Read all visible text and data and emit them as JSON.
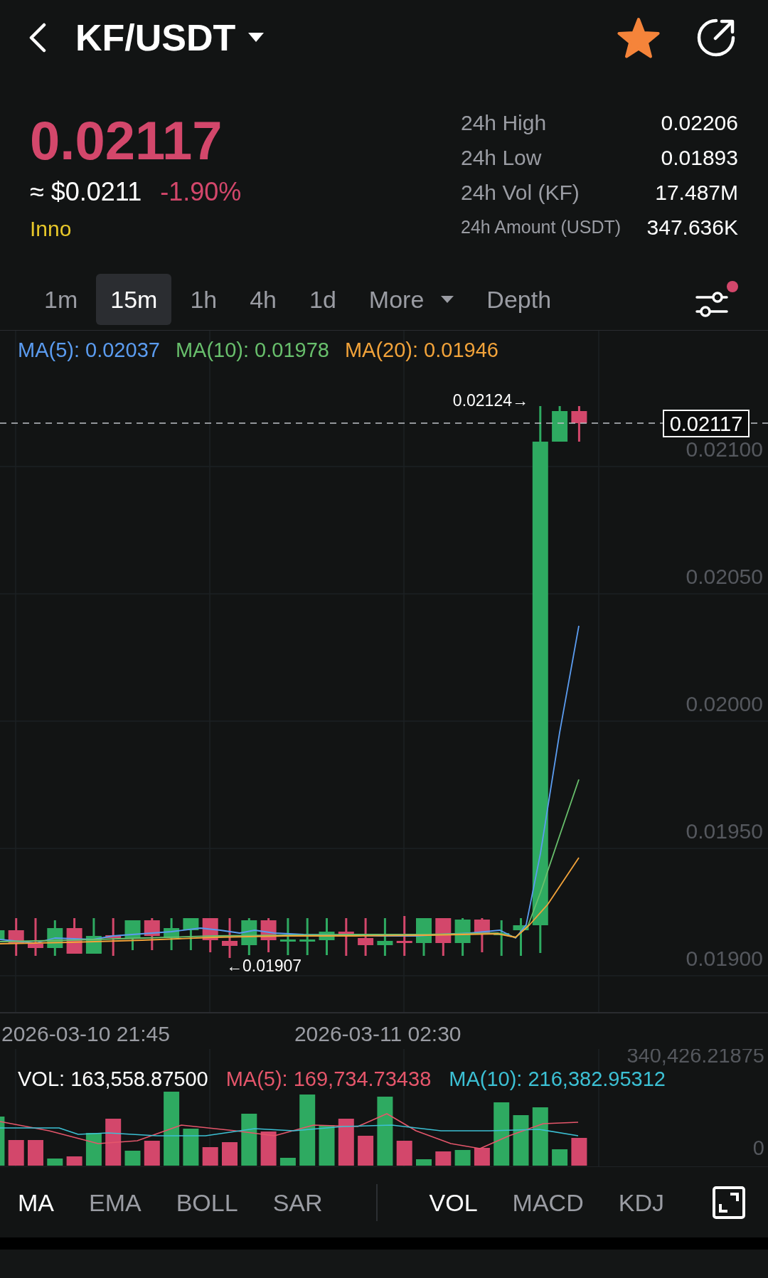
{
  "header": {
    "title": "KF/USDT",
    "favorite": true
  },
  "ticker": {
    "price": "0.02117",
    "falling": true,
    "usd_price": "≈ $0.0211",
    "change": "-1.90%",
    "tag": "Inno",
    "stats": [
      {
        "label": "24h High",
        "value": "0.02206"
      },
      {
        "label": "24h Low",
        "value": "0.01893"
      },
      {
        "label": "24h Vol (KF)",
        "value": "17.487M"
      },
      {
        "label": "24h Amount (USDT)",
        "value": "347.636K"
      }
    ]
  },
  "intervals": {
    "tabs": [
      {
        "label": "1m",
        "kind": "interval",
        "selected": false
      },
      {
        "label": "15m",
        "kind": "interval",
        "selected": true
      },
      {
        "label": "1h",
        "kind": "interval",
        "selected": false
      },
      {
        "label": "4h",
        "kind": "interval",
        "selected": false
      },
      {
        "label": "1d",
        "kind": "interval",
        "selected": false
      },
      {
        "label": "More",
        "kind": "menu",
        "selected": false
      },
      {
        "label": "Depth",
        "kind": "view",
        "selected": false
      }
    ],
    "settings_badge": true
  },
  "chart": {
    "legend": [
      {
        "label": "MA(5): 0.02037",
        "color": "#5b9cf0"
      },
      {
        "label": "MA(10): 0.01978",
        "color": "#68bf6c"
      },
      {
        "label": "MA(20): 0.01946",
        "color": "#f2a33a"
      }
    ],
    "price_axis": [
      "0.02100",
      "0.02050",
      "0.02000",
      "0.01950",
      "0.01900"
    ],
    "last_price": "0.02117",
    "high_marker": "0.02124→",
    "low_marker": "←0.01907",
    "time_axis": [
      "2026-03-10 21:45",
      "2026-03-11 02:30"
    ]
  },
  "volume": {
    "legend": [
      {
        "label": "VOL: 163,558.87500",
        "color": "#ffffff"
      },
      {
        "label": "MA(5): 169,734.73438",
        "color": "#e5566b"
      },
      {
        "label": "MA(10): 216,382.95312",
        "color": "#3cc0d4"
      }
    ],
    "axis": [
      "340,426.21875",
      "0"
    ]
  },
  "indicators": {
    "main": [
      {
        "label": "MA",
        "selected": true
      },
      {
        "label": "EMA",
        "selected": false
      },
      {
        "label": "BOLL",
        "selected": false
      },
      {
        "label": "SAR",
        "selected": false
      }
    ],
    "sub": [
      {
        "label": "VOL",
        "selected": true
      },
      {
        "label": "MACD",
        "selected": false
      },
      {
        "label": "KDJ",
        "selected": false
      }
    ]
  }
}
